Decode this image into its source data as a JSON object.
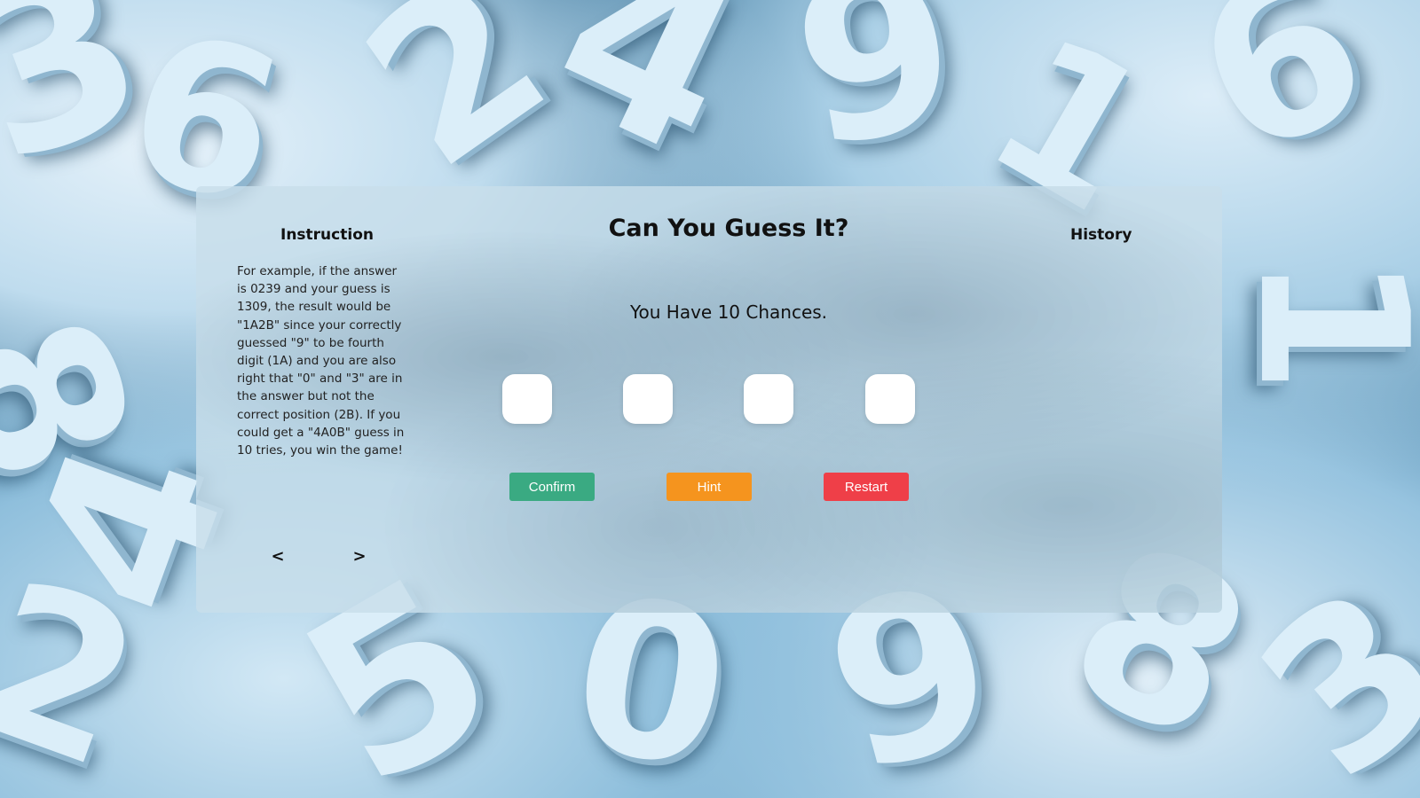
{
  "colors": {
    "confirm": "#3aaa82",
    "hint": "#f5941e",
    "restart": "#ef3f48",
    "panel": "#c8dee9"
  },
  "instruction": {
    "title": "Instruction",
    "text": "For example, if the answer is 0239 and your guess is 1309, the result would be \"1A2B\" since your correctly guessed \"9\" to be fourth digit (1A) and you are also right that \"0\" and \"3\" are in the answer but not the correct position (2B). If you could get a \"4A0B\" guess in 10 tries, you win the game!",
    "prev_label": "<",
    "next_label": ">"
  },
  "game": {
    "title": "Can You Guess It?",
    "chances_text": "You Have 10 Chances.",
    "digits": [
      "",
      "",
      "",
      ""
    ],
    "confirm_label": "Confirm",
    "hint_label": "Hint",
    "restart_label": "Restart"
  },
  "history": {
    "title": "History"
  }
}
